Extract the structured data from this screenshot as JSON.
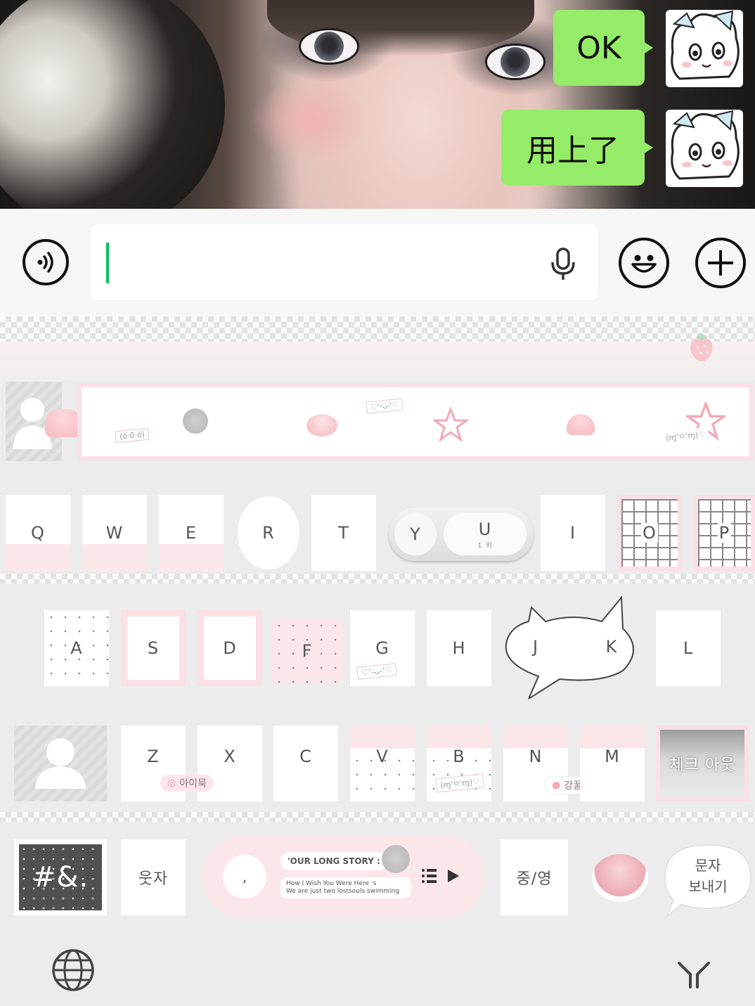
{
  "chat": {
    "messages": [
      {
        "text": "OK"
      },
      {
        "text": "用上了"
      }
    ]
  },
  "input_bar": {
    "placeholder": "",
    "voice_button": "speaker-wave-icon",
    "mic_button": "microphone-icon",
    "emoji_button": "smiley-icon",
    "more_button": "plus-icon"
  },
  "keyboard": {
    "decor": {
      "kaomoji_1": "(ó·0·ò)",
      "kaomoji_2": "♡'-ᴗ-'♡",
      "kaomoji_3": "(ɱ'ㅇ'ɱ)♡"
    },
    "row1": [
      "Q",
      "W",
      "E",
      "R",
      "T",
      "Y",
      "U",
      "I",
      "O",
      "P"
    ],
    "row2": [
      "A",
      "S",
      "D",
      "F",
      "G",
      "H",
      "J",
      "K",
      "L"
    ],
    "row3": [
      "Z",
      "X",
      "C",
      "V",
      "B",
      "N",
      "M"
    ],
    "row3_tags": {
      "z_tag": "아이묵",
      "n_tag": "강꿀기",
      "b_tag": "(ɱ'ㅇ'ɱ)♡",
      "g_tag": "♡'-ᴗ-'♡"
    },
    "check_key": "체크 아웃",
    "bottom": {
      "symbols": "#&.",
      "number_key": "웃자",
      "space_title": "'OUR LONG STORY :",
      "space_line1": "How I Wish You Were Here ·s",
      "space_line2": "We are just two lostsouls swimming",
      "space_comma": ",",
      "lang_key": "중/영",
      "send_key_line1": "문자",
      "send_key_line2": "보내기"
    },
    "u_key_sub": "1 위",
    "globe": "globe-icon",
    "collapse": "collapse-keyboard-icon"
  }
}
